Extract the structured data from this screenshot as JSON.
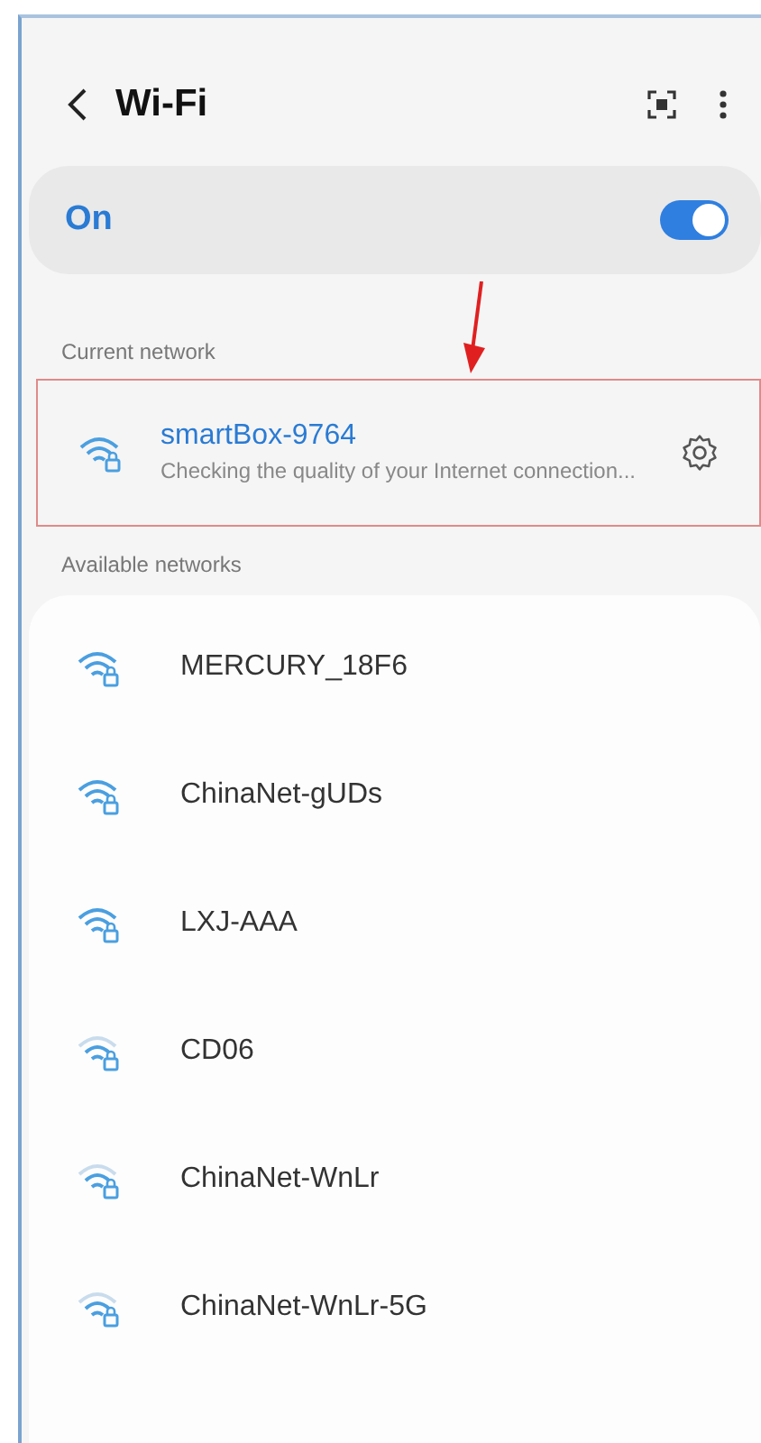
{
  "header": {
    "title": "Wi-Fi"
  },
  "master_switch": {
    "label": "On",
    "on": true
  },
  "current_network": {
    "heading": "Current network",
    "name": "smartBox-9764",
    "status": "Checking the quality of your Internet connection...",
    "highlighted": true
  },
  "available_networks": {
    "heading": "Available networks",
    "items": [
      {
        "name": "MERCURY_18F6",
        "weak": false
      },
      {
        "name": "ChinaNet-gUDs",
        "weak": false
      },
      {
        "name": "LXJ-AAA",
        "weak": false
      },
      {
        "name": "CD06",
        "weak": true
      },
      {
        "name": "ChinaNet-WnLr",
        "weak": true
      },
      {
        "name": "ChinaNet-WnLr-5G",
        "weak": true
      }
    ]
  }
}
